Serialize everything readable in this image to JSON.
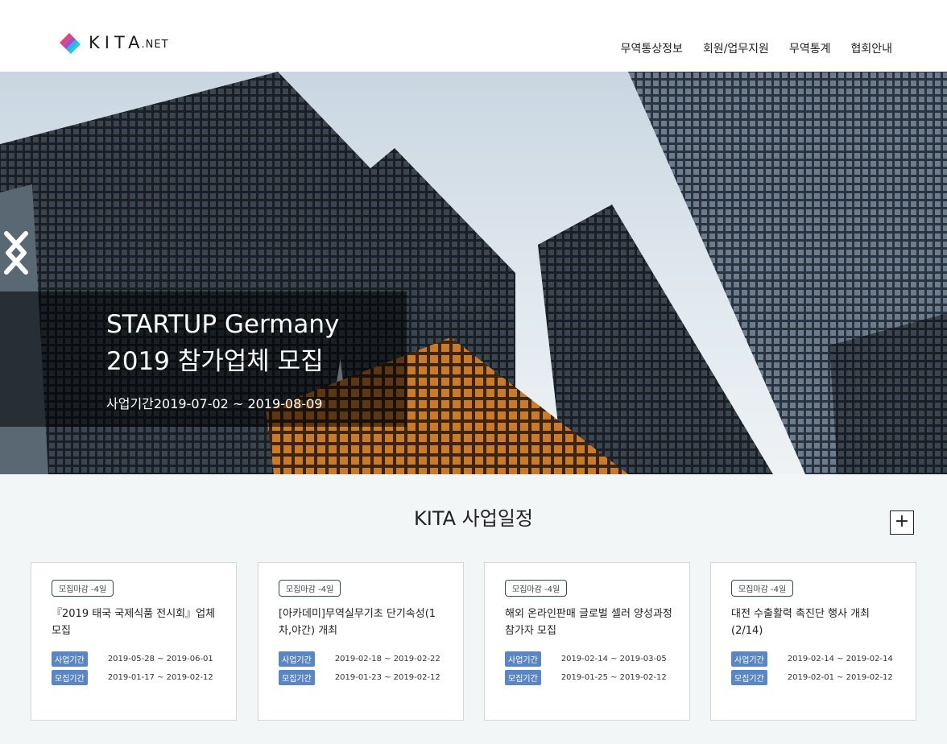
{
  "header": {
    "logo_text": "KITA",
    "logo_suffix": ".NET",
    "nav": [
      "무역통상정보",
      "회원/업무지원",
      "무역통계",
      "협회안내"
    ]
  },
  "hero": {
    "title_line1": "STARTUP Germany",
    "title_line2": "2019 참가업체 모집",
    "period": "사업기간2019-07-02 ~ 2019-08-09"
  },
  "schedule": {
    "title": "KITA 사업일정",
    "more_label": "+",
    "cards": [
      {
        "badge": "모집마감 -4일",
        "title": "『2019 태국 국제식품 전시회』업체모집",
        "business_label": "사업기간",
        "business_period": "2019-05-28 ~ 2019-06-01",
        "recruit_label": "모집기간",
        "recruit_period": "2019-01-17 ~ 2019-02-12"
      },
      {
        "badge": "모집마감 -4일",
        "title": "[아카데미]무역실무기초 단기속성(1차,야간) 개최",
        "business_label": "사업기간",
        "business_period": "2019-02-18 ~ 2019-02-22",
        "recruit_label": "모집기간",
        "recruit_period": "2019-01-23 ~ 2019-02-12"
      },
      {
        "badge": "모집마감 -4일",
        "title": "해외 온라인판매 글로벌 셀러 양성과정 참가자 모집",
        "business_label": "사업기간",
        "business_period": "2019-02-14 ~ 2019-03-05",
        "recruit_label": "모집기간",
        "recruit_period": "2019-01-25 ~ 2019-02-12"
      },
      {
        "badge": "모집마감 -4일",
        "title": "대전 수출활력 촉진단 행사 개최(2/14)",
        "business_label": "사업기간",
        "business_period": "2019-02-14 ~ 2019-02-14",
        "recruit_label": "모집기간",
        "recruit_period": "2019-02-01 ~ 2019-02-12"
      }
    ]
  }
}
